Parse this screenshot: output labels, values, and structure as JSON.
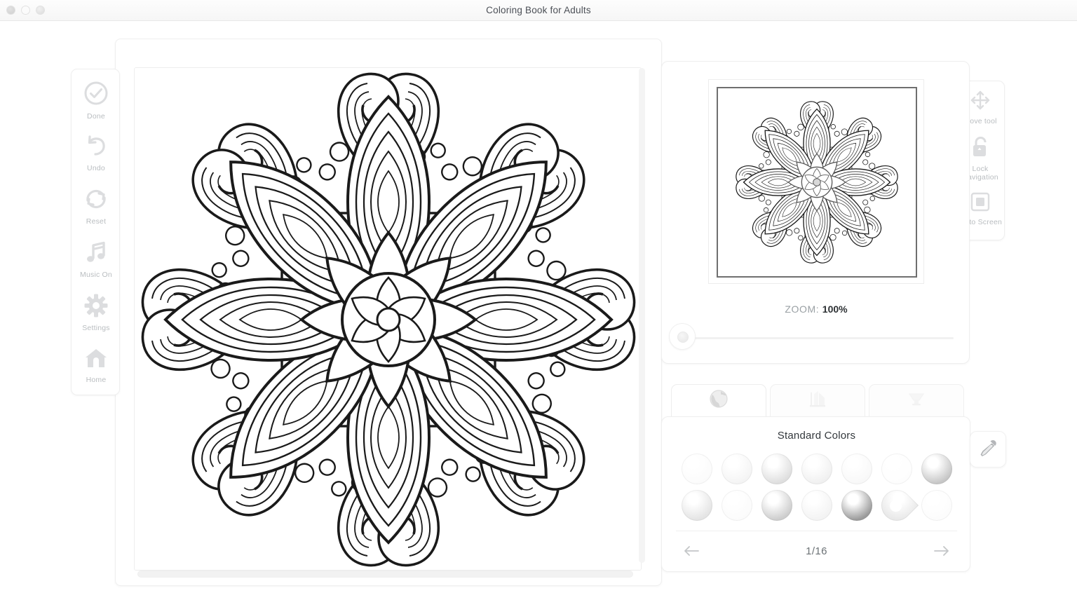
{
  "window": {
    "title": "Coloring Book for Adults",
    "traffic_lights": [
      "close",
      "minimize",
      "zoom"
    ]
  },
  "left_toolbar": {
    "items": [
      {
        "label": "Done",
        "icon": "check-circle-icon"
      },
      {
        "label": "Undo",
        "icon": "undo-arrow-icon"
      },
      {
        "label": "Reset",
        "icon": "refresh-circular-arrows-icon"
      },
      {
        "label": "Music On",
        "icon": "music-note-icon"
      },
      {
        "label": "Settings",
        "icon": "gear-icon"
      },
      {
        "label": "Home",
        "icon": "house-icon"
      }
    ]
  },
  "right_toolbar": {
    "items": [
      {
        "label": "Move tool",
        "icon": "move-arrows-icon"
      },
      {
        "label": "Lock Navigation",
        "icon": "padlock-icon"
      },
      {
        "label": "Fit to Screen",
        "icon": "fit-square-icon"
      }
    ]
  },
  "navigator": {
    "zoom_prefix": "ZOOM:",
    "zoom_value": "100%",
    "slider_position_percent": 0
  },
  "palette": {
    "tabs": [
      {
        "name": "colors",
        "icon": "color-sphere-icon",
        "active": true
      },
      {
        "name": "patterns",
        "icon": "pattern-swatch-icon",
        "active": false
      },
      {
        "name": "gradients",
        "icon": "gradient-bucket-icon",
        "active": false
      }
    ],
    "title": "Standard Colors",
    "page_label": "1/16",
    "prev_icon": "arrow-left-icon",
    "next_icon": "arrow-right-icon",
    "eyedropper_icon": "eyedropper-icon",
    "swatches": [
      {
        "id": 1,
        "color": "#fbfbfb",
        "selected": false
      },
      {
        "id": 2,
        "color": "#f4f4f4",
        "selected": false
      },
      {
        "id": 3,
        "color": "#dedede",
        "selected": false
      },
      {
        "id": 4,
        "color": "#f0f0f0",
        "selected": false
      },
      {
        "id": 5,
        "color": "#f8f8f8",
        "selected": false
      },
      {
        "id": 6,
        "color": "#fdfdfd",
        "selected": false
      },
      {
        "id": 7,
        "color": "#c6c6c6",
        "selected": false
      },
      {
        "id": 8,
        "color": "#e4e4e4",
        "selected": false
      },
      {
        "id": 9,
        "color": "#fbfbfb",
        "selected": false
      },
      {
        "id": 10,
        "color": "#cdcdcd",
        "selected": false
      },
      {
        "id": 11,
        "color": "#f3f3f3",
        "selected": false
      },
      {
        "id": 12,
        "color": "#9b9b9b",
        "selected": false
      },
      {
        "id": 13,
        "color": "#e9e9e9",
        "selected": true
      },
      {
        "id": 14,
        "color": "#fcfcfc",
        "selected": false
      }
    ]
  },
  "canvas": {
    "artwork_name": "floral-mandala-line-art",
    "line_color": "#1a1a1a",
    "background": "#ffffff",
    "v_scrollbar": "vertical-scrollbar",
    "h_scrollbar": "horizontal-scrollbar"
  },
  "colors": {
    "accent_text": "#2d3134",
    "muted_text": "#b9bdc0",
    "panel_bg": "#ffffff",
    "border": "#efefef"
  }
}
